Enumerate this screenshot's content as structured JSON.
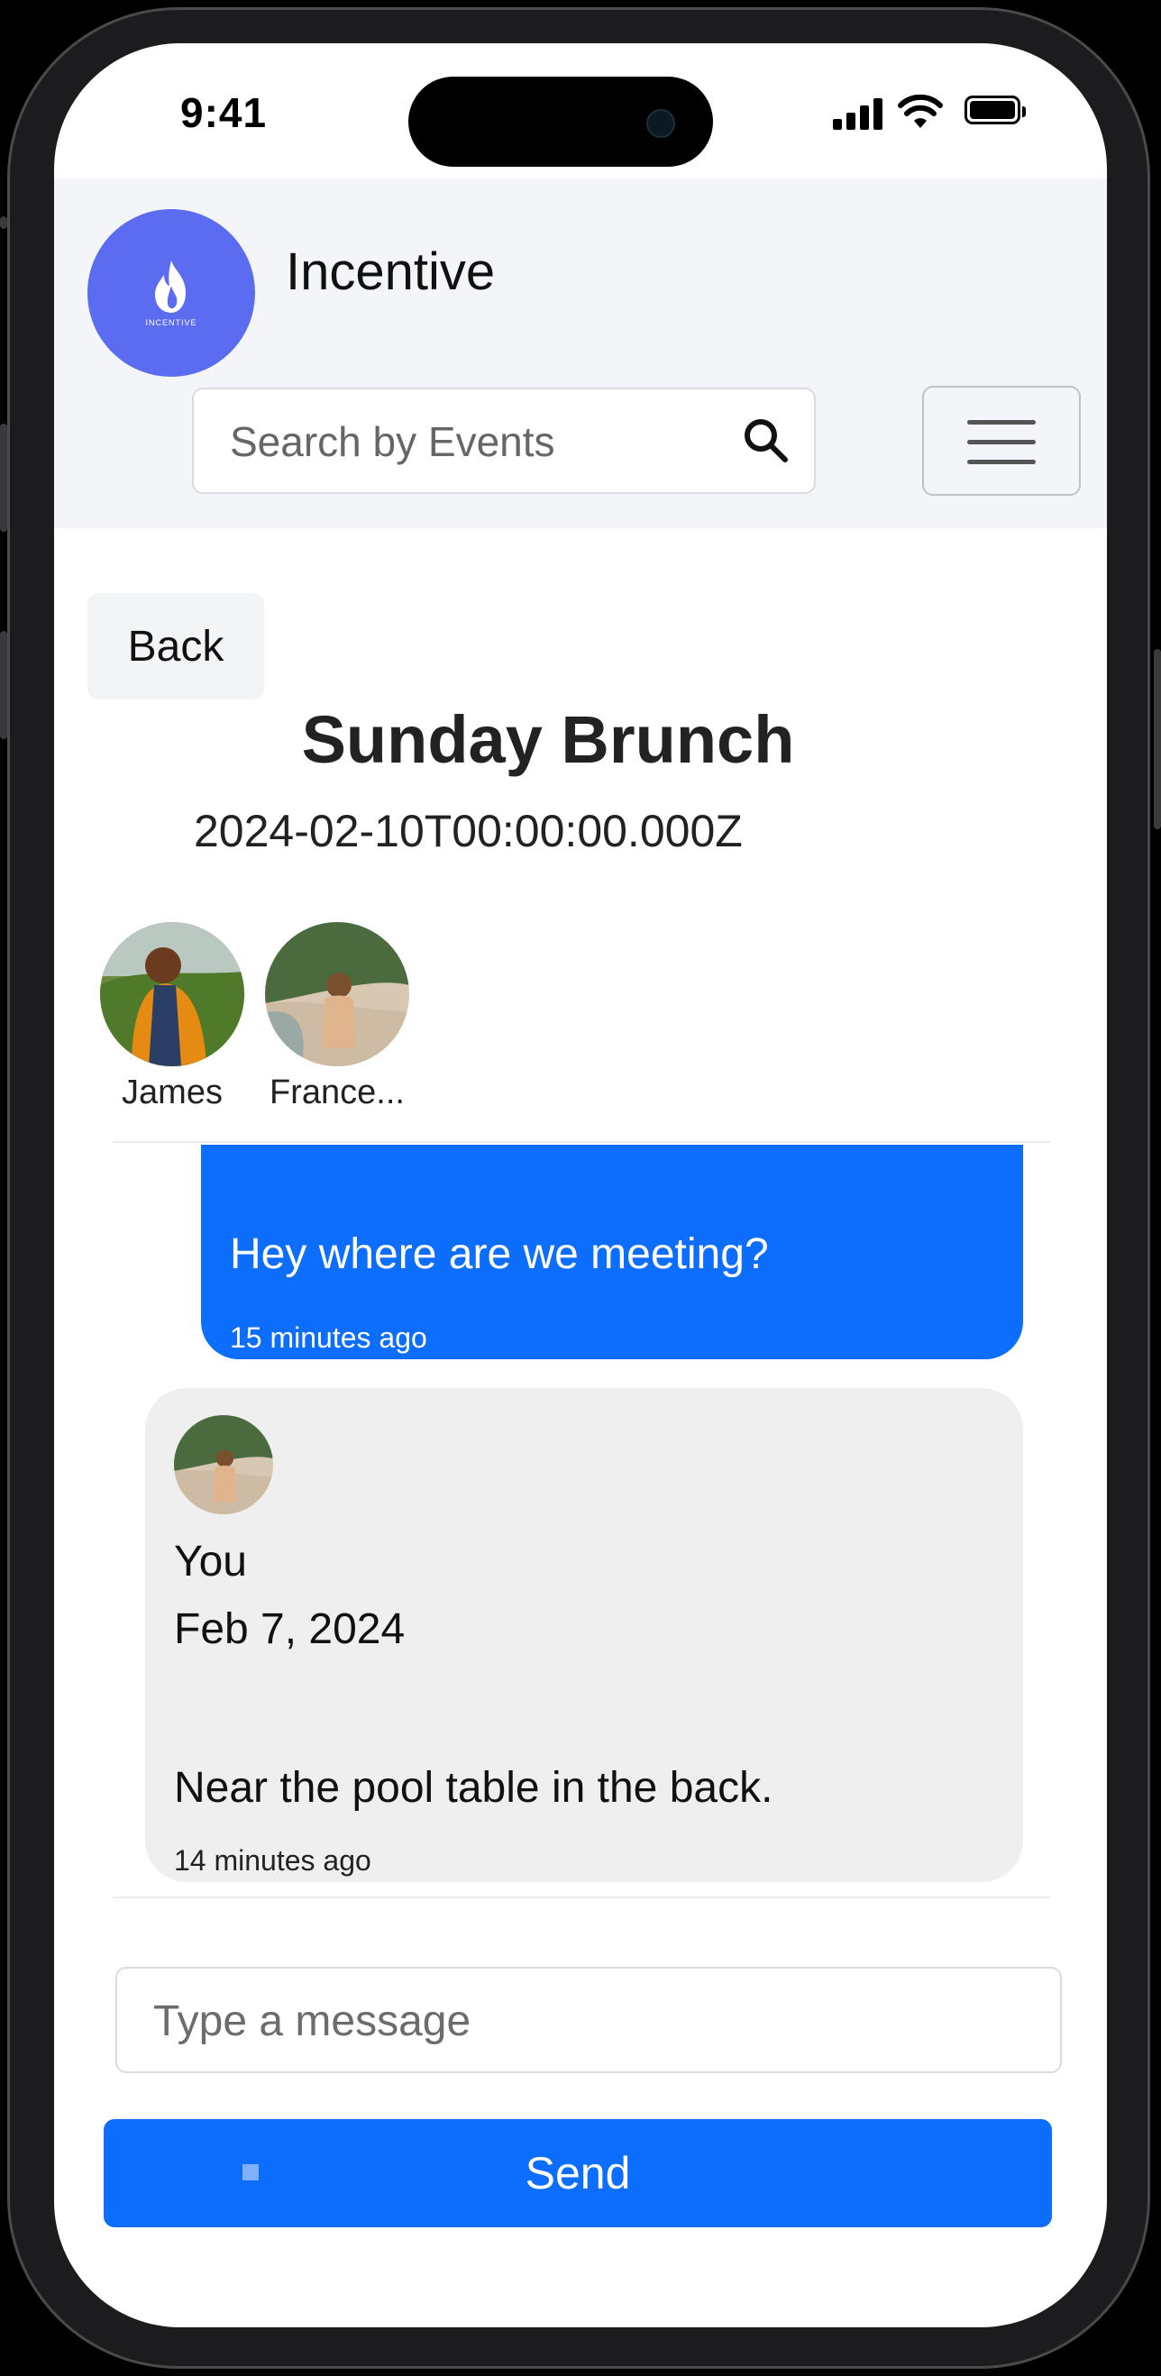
{
  "status_bar": {
    "time": "9:41"
  },
  "header": {
    "logo_text": "INCENTIVE",
    "brand": "Incentive",
    "search_placeholder": "Search by Events"
  },
  "event": {
    "back_label": "Back",
    "title": "Sunday Brunch",
    "date": "2024-02-10T00:00:00.000Z"
  },
  "participants": [
    {
      "name": "James"
    },
    {
      "name": "France..."
    }
  ],
  "messages": [
    {
      "text": "Hey where are we meeting?",
      "ago": "15 minutes ago"
    },
    {
      "sender": "You",
      "date": "Feb 7, 2024",
      "text": "Near the pool table in the back.",
      "ago": "14 minutes ago"
    }
  ],
  "composer": {
    "placeholder": "Type a message",
    "send_label": "Send"
  },
  "colors": {
    "accent": "#0d6efd",
    "logo": "#5b6cf0",
    "header_bg": "#f4f5f8",
    "received_bubble": "#efefef"
  }
}
